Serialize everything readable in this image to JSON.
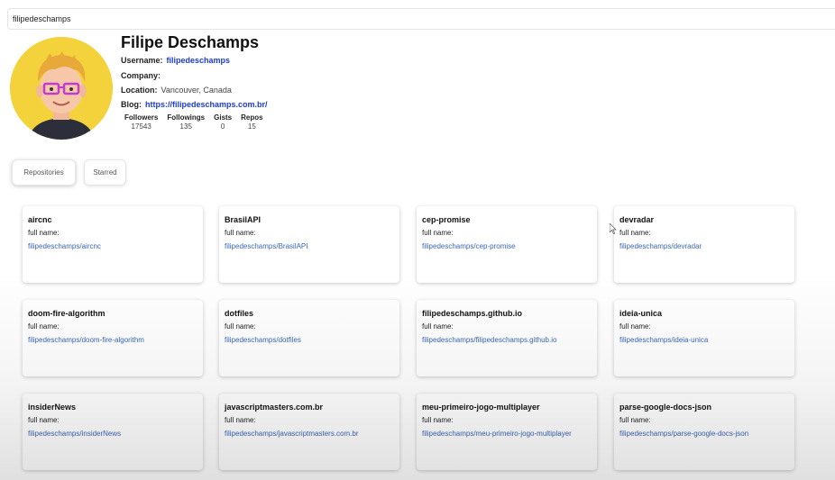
{
  "search": {
    "value": "filipedeschamps"
  },
  "profile": {
    "name": "Filipe Deschamps",
    "username_label": "Username:",
    "username": "filipedeschamps",
    "company_label": "Company:",
    "company": "",
    "location_label": "Location:",
    "location": "Vancouver, Canada",
    "blog_label": "Blog:",
    "blog": "https://filipedeschamps.com.br/",
    "stats": [
      {
        "label": "Followers",
        "value": "17543"
      },
      {
        "label": "Followings",
        "value": "135"
      },
      {
        "label": "Gists",
        "value": "0"
      },
      {
        "label": "Repos",
        "value": "15"
      }
    ]
  },
  "tabs": [
    {
      "label": "Repositories",
      "active": true
    },
    {
      "label": "Starred",
      "active": false
    }
  ],
  "fullname_label": "full name:",
  "repos": [
    {
      "name": "aircnc",
      "link": "filipedeschamps/aircnc"
    },
    {
      "name": "BrasilAPI",
      "link": "filipedeschamps/BrasilAPI"
    },
    {
      "name": "cep-promise",
      "link": "filipedeschamps/cep-promise"
    },
    {
      "name": "devradar",
      "link": "filipedeschamps/devradar"
    },
    {
      "name": "doom-fire-algorithm",
      "link": "filipedeschamps/doom-fire-algorithm"
    },
    {
      "name": "dotfiles",
      "link": "filipedeschamps/dotfiles"
    },
    {
      "name": "filipedeschamps.github.io",
      "link": "filipedeschamps/filipedeschamps.github.io"
    },
    {
      "name": "ideia-unica",
      "link": "filipedeschamps/ideia-unica"
    },
    {
      "name": "insiderNews",
      "link": "filipedeschamps/insiderNews"
    },
    {
      "name": "javascriptmasters.com.br",
      "link": "filipedeschamps/javascriptmasters.com.br"
    },
    {
      "name": "meu-primeiro-jogo-multiplayer",
      "link": "filipedeschamps/meu-primeiro-jogo-multiplayer"
    },
    {
      "name": "parse-google-docs-json",
      "link": "filipedeschamps/parse-google-docs-json"
    }
  ],
  "colors": {
    "accent_link": "#1b3bd6",
    "repo_link": "#3a66b8",
    "avatar_bg": "#f3d23c"
  }
}
